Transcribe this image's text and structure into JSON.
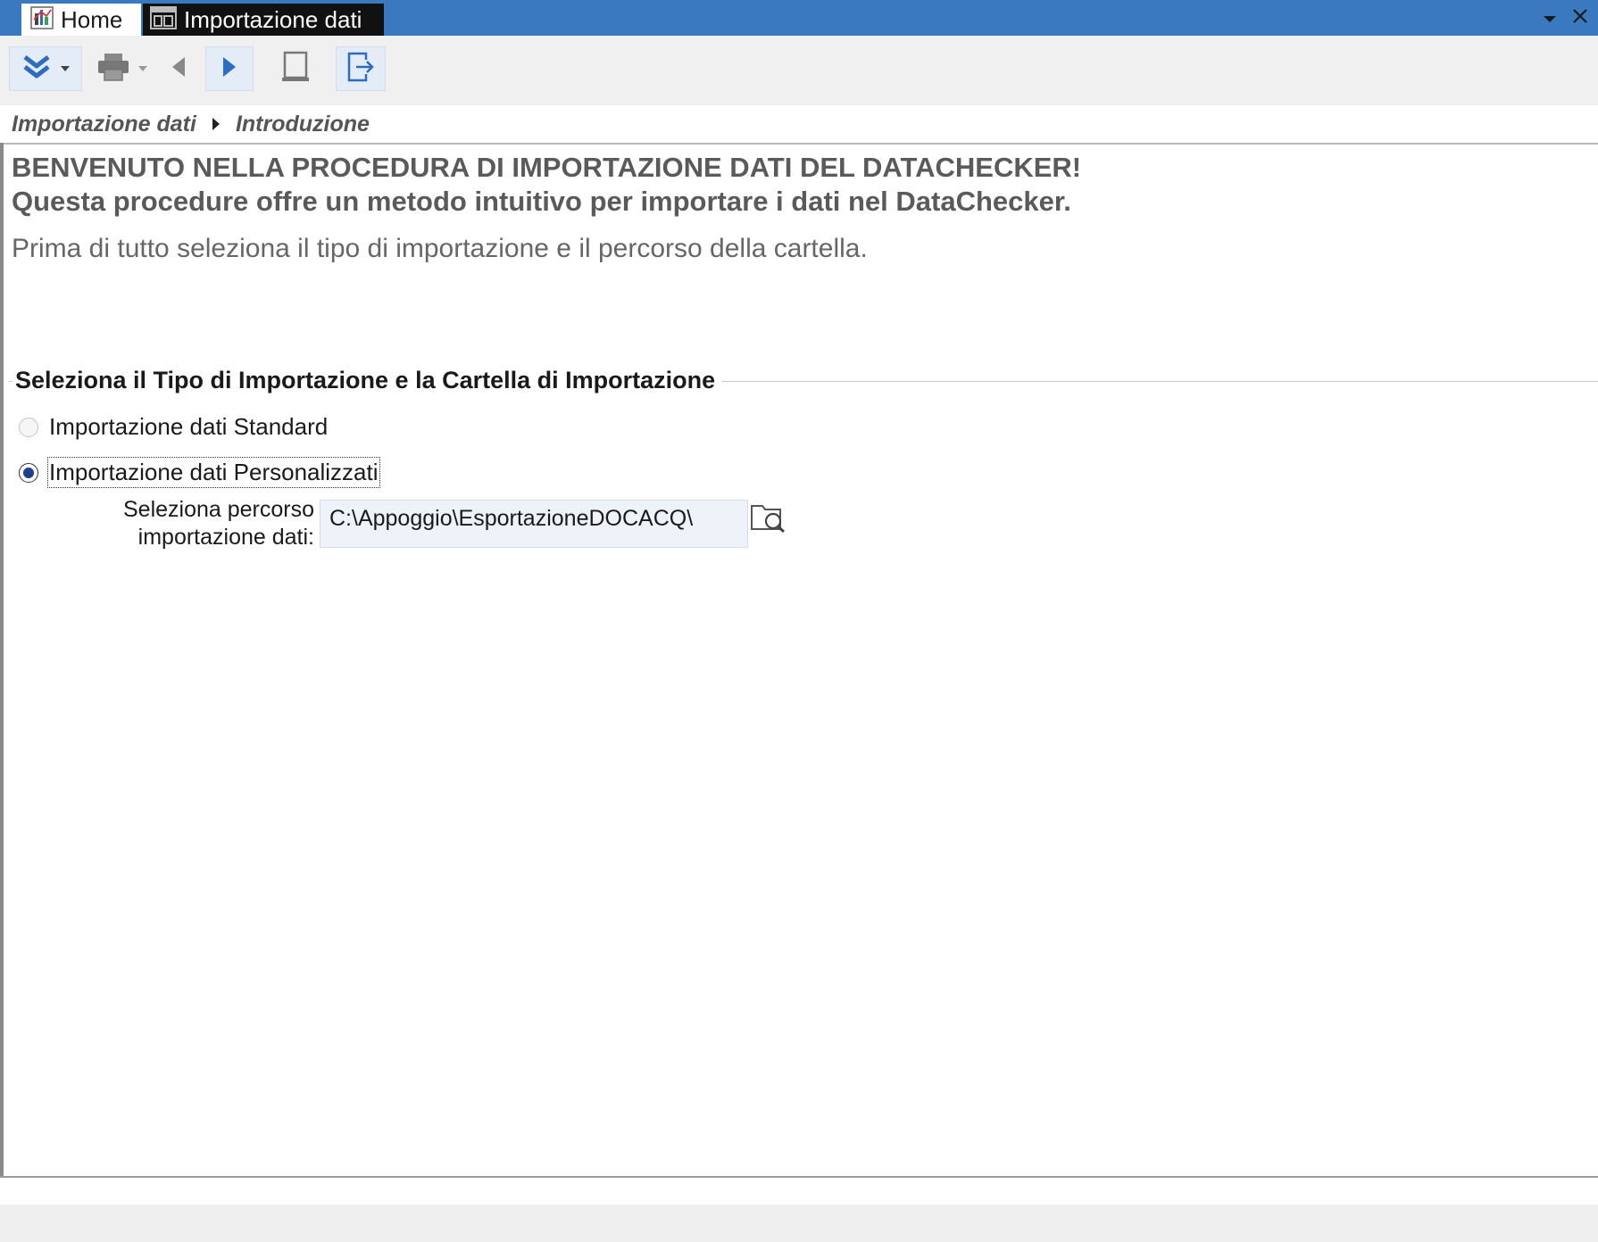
{
  "tabs": [
    {
      "label": "Home",
      "icon": "home-app-icon",
      "active": false
    },
    {
      "label": "Importazione dati",
      "icon": "form-window-icon",
      "active": true
    }
  ],
  "window_controls": {
    "menu": "chevron-down-icon",
    "close": "close-icon"
  },
  "toolbar": {
    "buttons": [
      {
        "name": "expand-down-button",
        "icon": "double-chevron-down-icon",
        "has_dropdown": true
      },
      {
        "name": "print-button",
        "icon": "printer-icon",
        "has_dropdown": true,
        "disabled": true
      },
      {
        "name": "back-button",
        "icon": "triangle-left-icon",
        "disabled": true
      },
      {
        "name": "next-button",
        "icon": "triangle-right-icon"
      },
      {
        "name": "cancel-button",
        "icon": "document-icon",
        "disabled": true
      },
      {
        "name": "exit-button",
        "icon": "exit-icon"
      }
    ]
  },
  "breadcrumb": {
    "items": [
      "Importazione dati",
      "Introduzione"
    ]
  },
  "welcome": {
    "title_line1": "BENVENUTO NELLA PROCEDURA DI IMPORTAZIONE DATI DEL DATACHECKER!",
    "title_line2": "Questa procedure offre un metodo intuitivo per importare i dati nel DataChecker.",
    "intro": "Prima di tutto seleziona il tipo di importazione e il percorso della cartella."
  },
  "import_group": {
    "title": "Seleziona il Tipo di Importazione e la Cartella di Importazione",
    "options": [
      {
        "label": "Importazione dati Standard",
        "selected": false
      },
      {
        "label": "Importazione dati Personalizzati",
        "selected": true
      }
    ],
    "path_label_line1": "Seleziona percorso",
    "path_label_line2": "importazione dati:",
    "path_value": "C:\\Appoggio\\EsportazioneDOCACQ\\"
  },
  "colors": {
    "titlebar": "#3a79c0",
    "accent_blue": "#2d6cc0",
    "radio_dot": "#1f3f8e",
    "heading_gray": "#5a5a5a"
  }
}
